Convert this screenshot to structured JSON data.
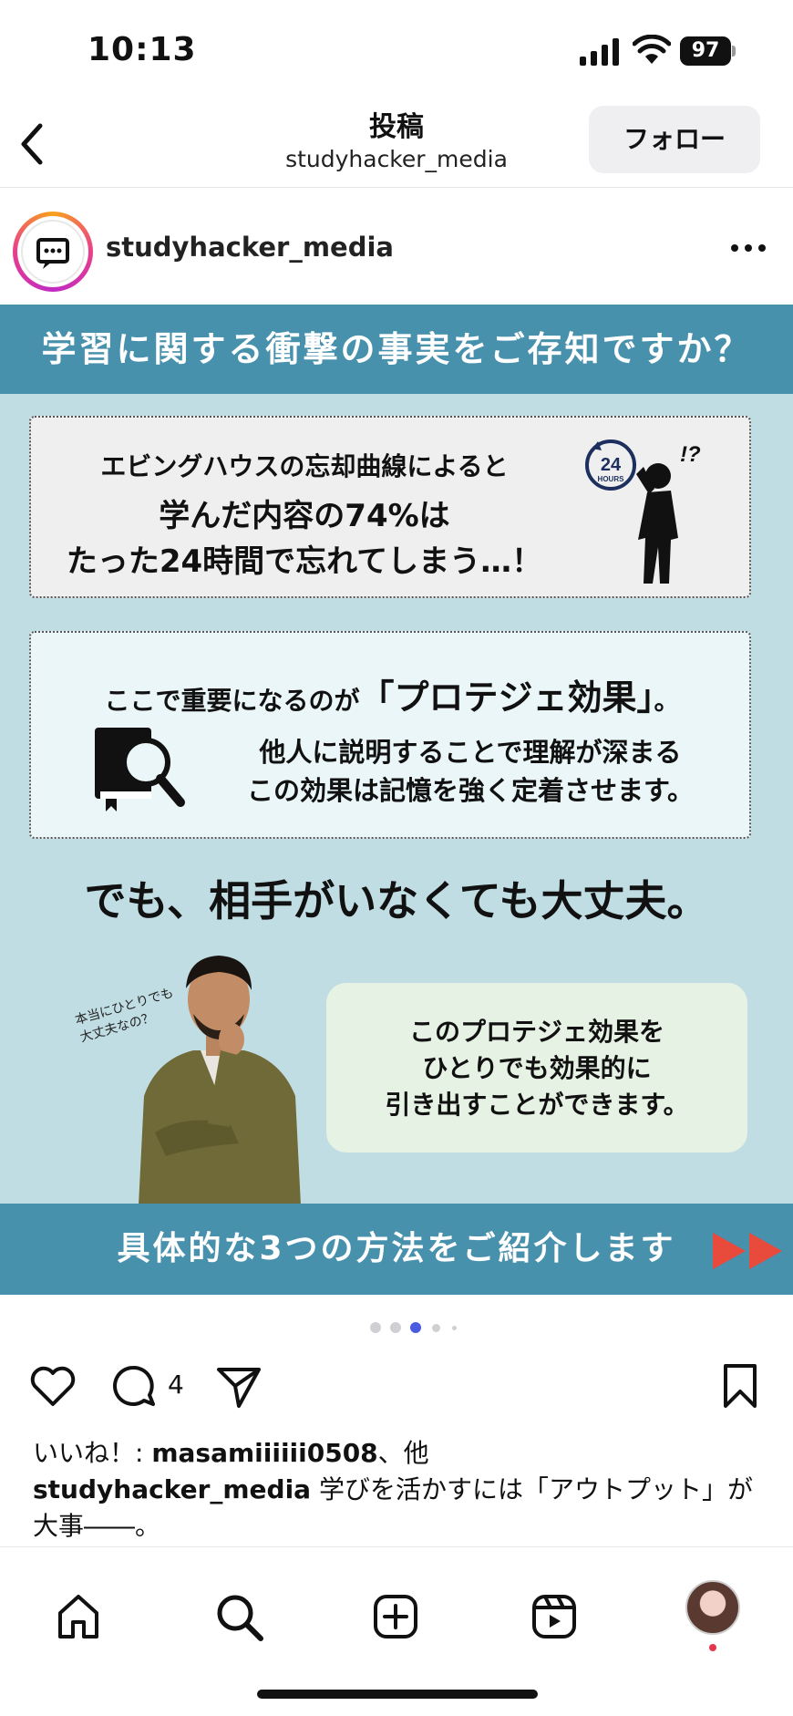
{
  "status_bar": {
    "time": "10:13",
    "battery": "97"
  },
  "header": {
    "title": "投稿",
    "subtitle": "studyhacker_media",
    "follow_label": "フォロー"
  },
  "post_header": {
    "username": "studyhacker_media"
  },
  "post_image": {
    "top_banner": "学習に関する衝撃の事実をご存知ですか？",
    "card1": {
      "line1": "エビングハウスの忘却曲線によると",
      "line2": "学んだ内容の74%は",
      "line3": "たった24時間で忘れてしまう…！",
      "badge_number": "24",
      "badge_unit": "HOURS",
      "exclaim": "!?"
    },
    "card2": {
      "line1_pre": "ここで重要になるのが",
      "line1_big": "「プロテジェ効果」",
      "line1_post": "。",
      "line2": "他人に説明することで理解が深まる",
      "line3": "この効果は記憶を強く定着させます。"
    },
    "headline": "でも、相手がいなくても大丈夫。",
    "handwritten_note": "本当にひとりでも\n大丈夫なの？",
    "bubble": {
      "line1": "このプロテジェ効果を",
      "line2": "ひとりでも効果的に",
      "line3": "引き出すことができます。"
    },
    "bottom_banner": "具体的な3つの方法をご紹介します"
  },
  "carousel": {
    "total": 5,
    "active_index": 2
  },
  "actions": {
    "comment_count": "4"
  },
  "likes": {
    "prefix": "いいね！: ",
    "user": "masamiiiiii0508",
    "suffix": "、他"
  },
  "caption": {
    "user": "studyhacker_media",
    "text": " 学びを活かすには「アウトプット」が大事――。"
  },
  "tabbar": {
    "items": [
      "home",
      "search",
      "create",
      "reels",
      "profile"
    ]
  },
  "colors": {
    "banner": "#4891ad",
    "post_bg": "#c1dde4",
    "accent_arrow": "#e84a3c",
    "active_dot": "#4a5be0"
  }
}
